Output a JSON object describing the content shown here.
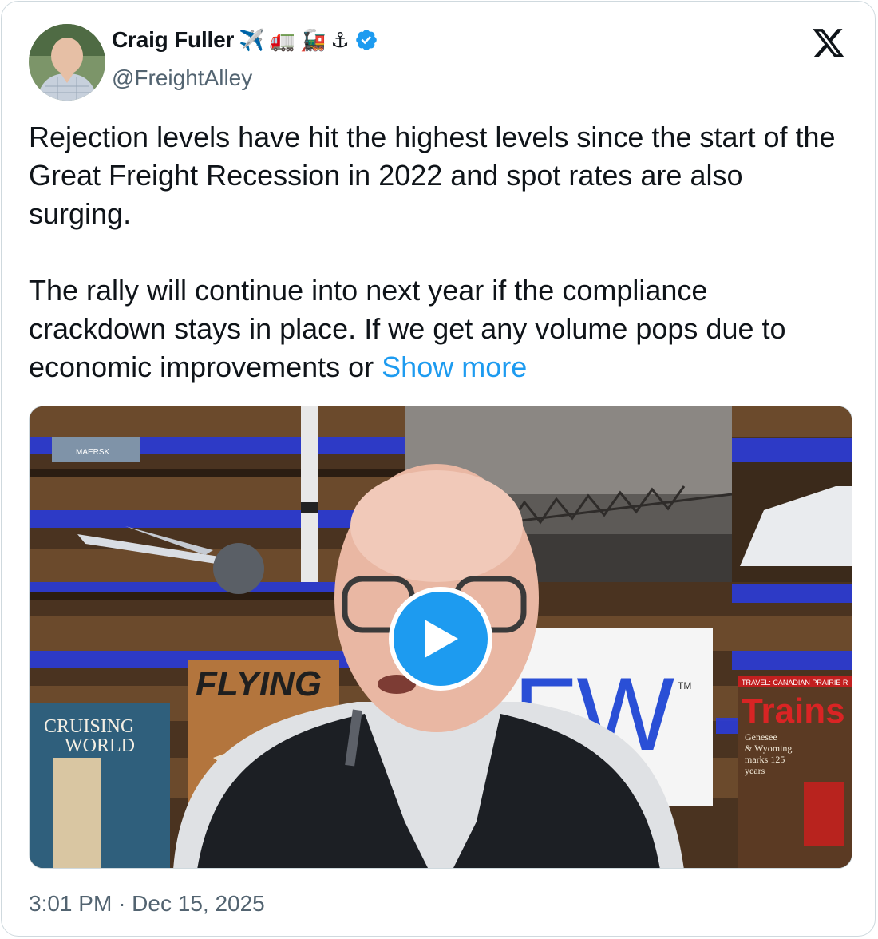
{
  "author": {
    "display_name": "Craig Fuller",
    "emojis": [
      "✈️",
      "🚛",
      "🚂",
      "⚓"
    ],
    "handle": "@FreightAlley",
    "verified": true
  },
  "tweet": {
    "paragraph_1": "Rejection levels have hit the highest levels since the start of the Great Freight Recession in 2022 and spot rates are also surging.",
    "paragraph_2_text": "The rally will continue into next year if the compliance crackdown stays in place. If we get any volume pops due to economic improvements or ",
    "show_more": "Show more"
  },
  "media": {
    "type": "video",
    "background_text": {
      "magazine_1_title_line1": "CRUISING",
      "magazine_1_title_line2": "WORLD",
      "magazine_2_title": "FLYING",
      "magazine_3_header": "TRAVEL: CANADIAN PRAIRIE R",
      "magazine_3_title": "Trains",
      "magazine_3_cover_line1": "Genesee",
      "magazine_3_cover_line2": "& Wyoming",
      "magazine_3_cover_line3": "marks 125",
      "magazine_3_cover_line4": "years",
      "sign_text": "FW",
      "sign_tm": "TM",
      "container_text": "MAERSK"
    }
  },
  "footer": {
    "time": "3:01 PM",
    "separator": "·",
    "date": "Dec 15, 2025"
  },
  "colors": {
    "accent": "#1d9bf0",
    "secondary_text": "#536471",
    "verified": "#1d9bf0"
  }
}
